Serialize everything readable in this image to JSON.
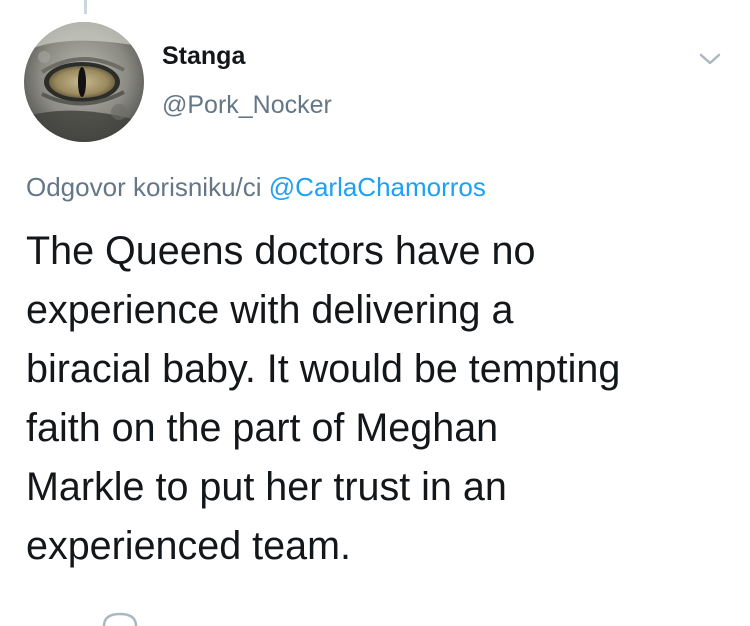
{
  "tweet": {
    "display_name": "Stanga",
    "handle": "@Pork_Nocker",
    "reply_prefix": "Odgovor korisniku/ci",
    "reply_mention": "@CarlaChamorros",
    "text_lines": [
      "The Queens doctors have no",
      "experience with delivering a",
      "biracial baby. It would be tempting",
      "faith on the part of Meghan",
      "Markle to put her trust in an",
      "experienced team."
    ]
  },
  "icons": {
    "menu": "chevron-down-icon",
    "avatar": "lizard-eye-avatar"
  },
  "colors": {
    "text": "#14171a",
    "secondary": "#657786",
    "link": "#1da1f2"
  }
}
